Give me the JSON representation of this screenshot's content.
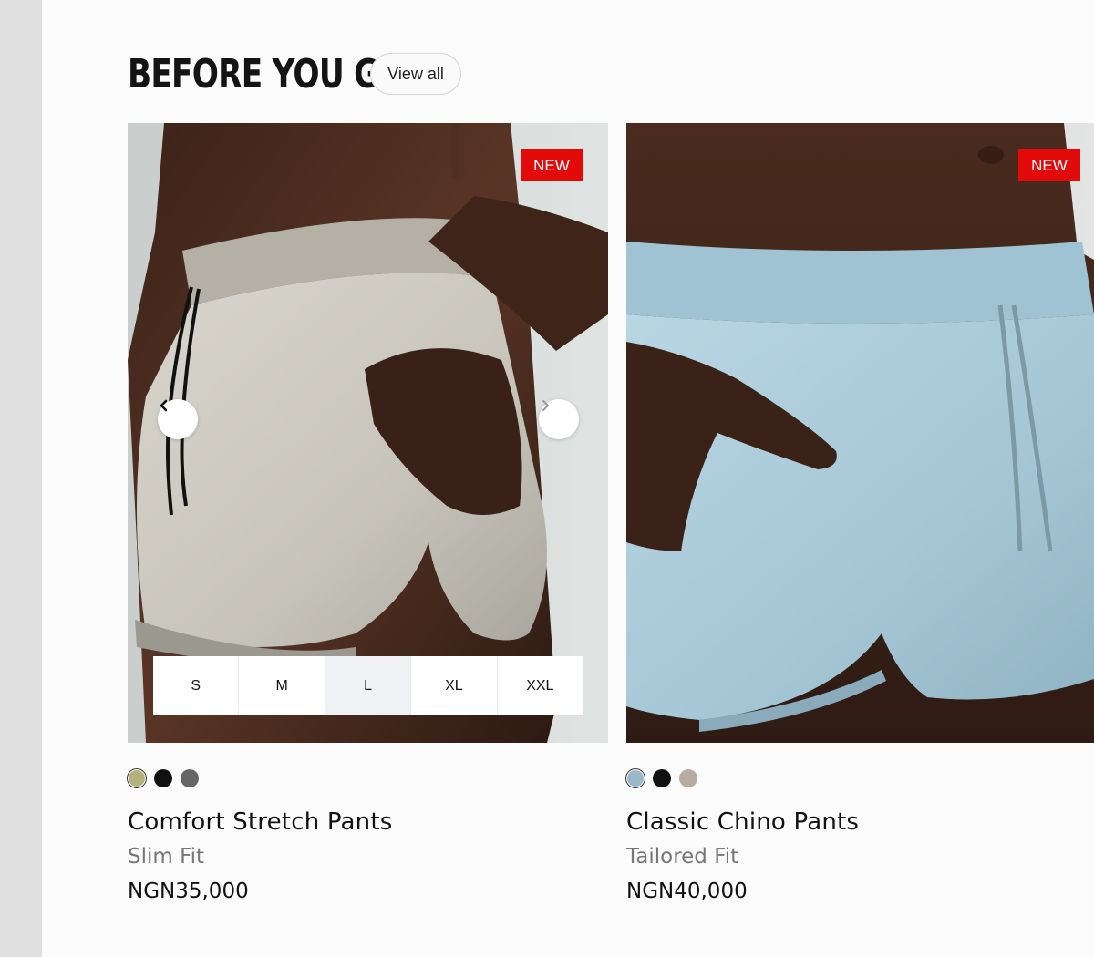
{
  "section": {
    "title": "BEFORE YOU GO",
    "view_all_label": "View all"
  },
  "products": [
    {
      "badge": "NEW",
      "name": "Comfort Stretch Pants",
      "fit": "Slim Fit",
      "price": "NGN35,000",
      "image_icon": "beige-shorts-photo",
      "swatches": [
        "#b2b27a",
        "#111111",
        "#666666"
      ],
      "active_swatch": 0,
      "sizes": [
        "S",
        "M",
        "L",
        "XL",
        "XXL"
      ],
      "selected_size": "L"
    },
    {
      "badge": "NEW",
      "name": "Classic Chino Pants",
      "fit": "Tailored Fit",
      "price": "NGN40,000",
      "image_icon": "light-blue-shorts-photo",
      "swatches": [
        "#9ab8c8",
        "#111111",
        "#b8aca0"
      ],
      "active_swatch": 0
    }
  ]
}
